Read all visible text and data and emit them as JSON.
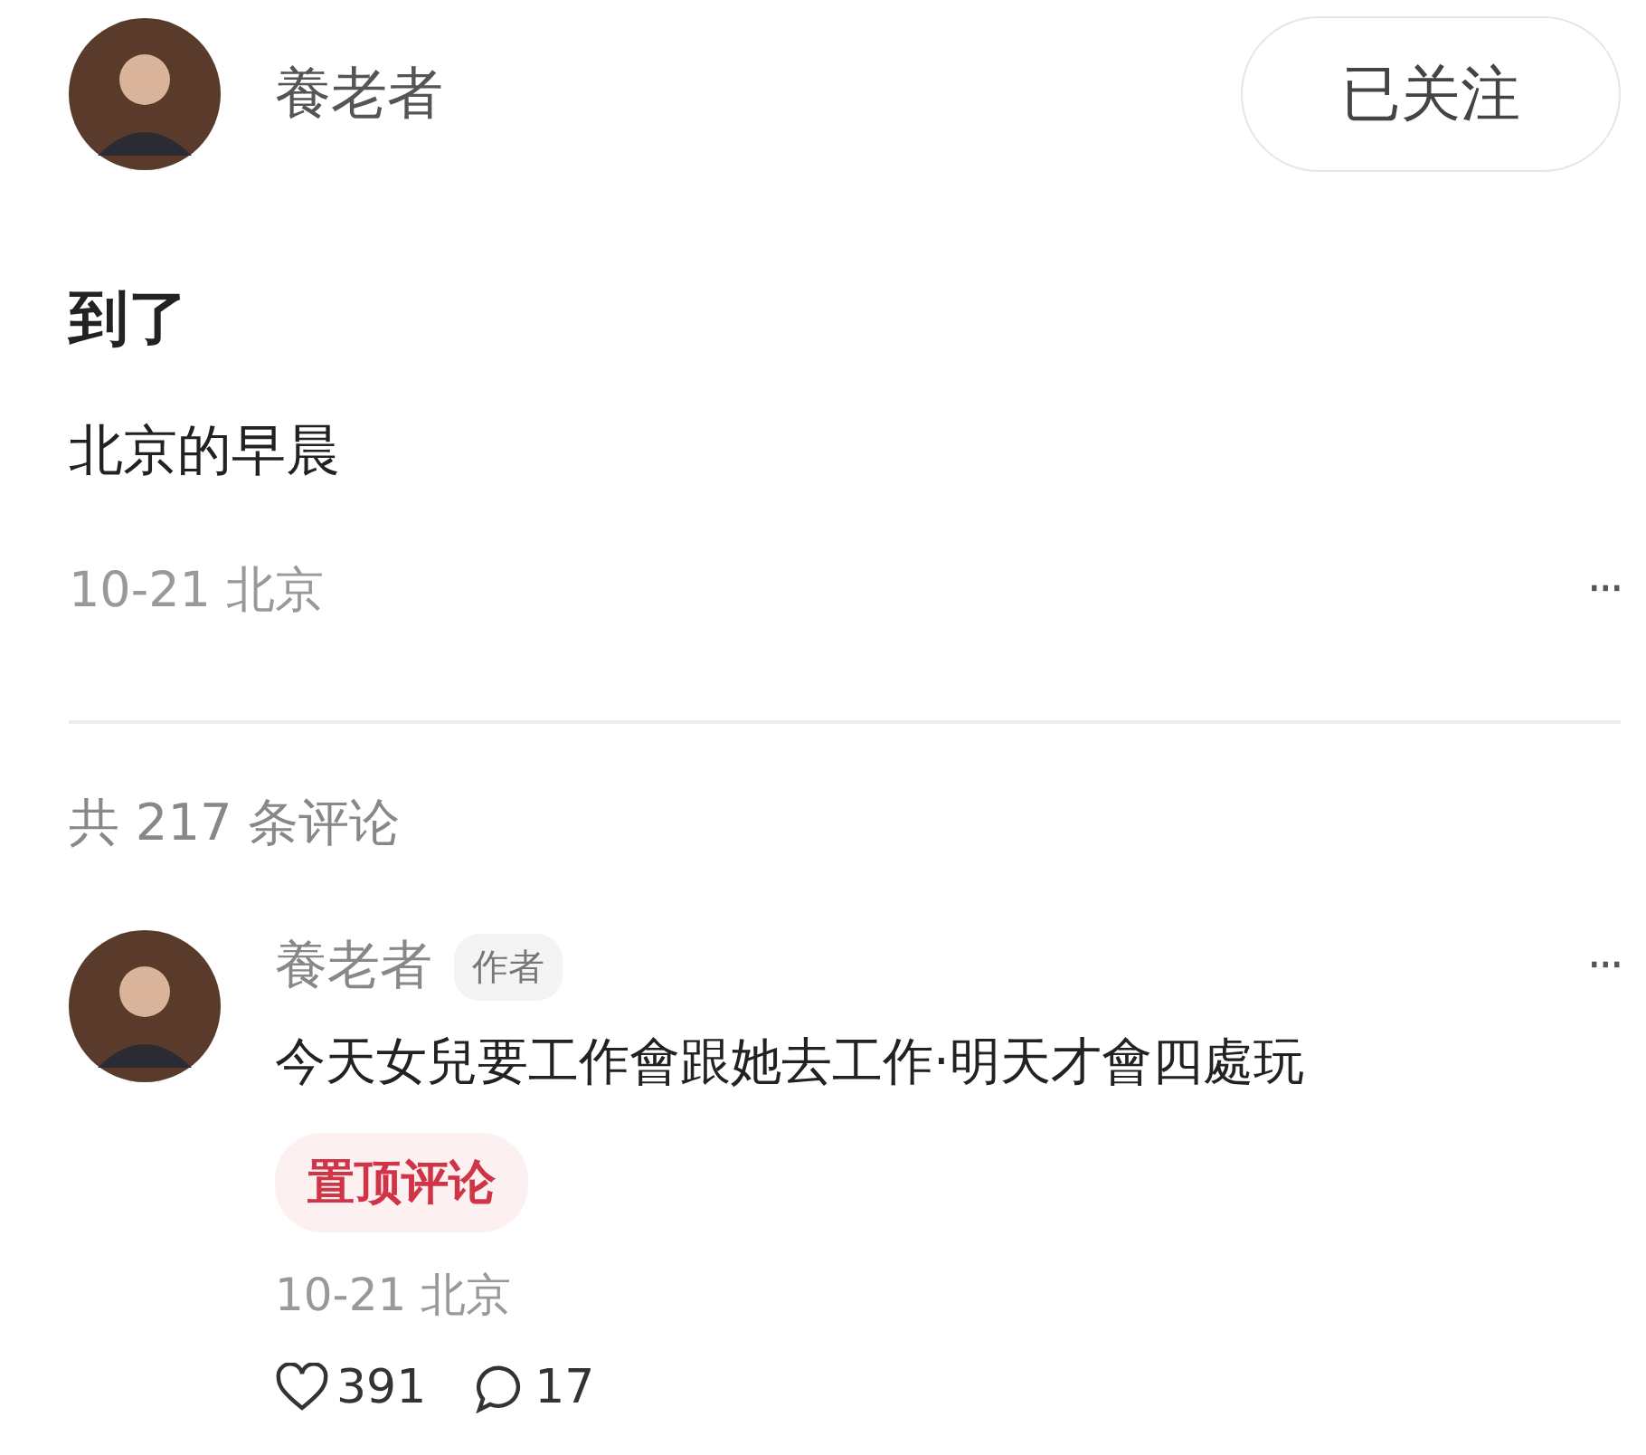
{
  "post": {
    "author": "養老者",
    "follow_button": {
      "label": "已关注",
      "followed": true
    },
    "title": "到了",
    "body": "北京的早晨",
    "meta": "10-21 北京",
    "more": "···"
  },
  "comments_header": "共 217 条评论",
  "comments": [
    {
      "author": "養老者",
      "badge": "作者",
      "text": "今天女兒要工作會跟她去工作·明天才會四處玩",
      "pinned": true,
      "pinned_label": "置顶评论",
      "meta": "10-21 北京",
      "likes": "391",
      "replies": "17",
      "more": "···"
    }
  ]
}
